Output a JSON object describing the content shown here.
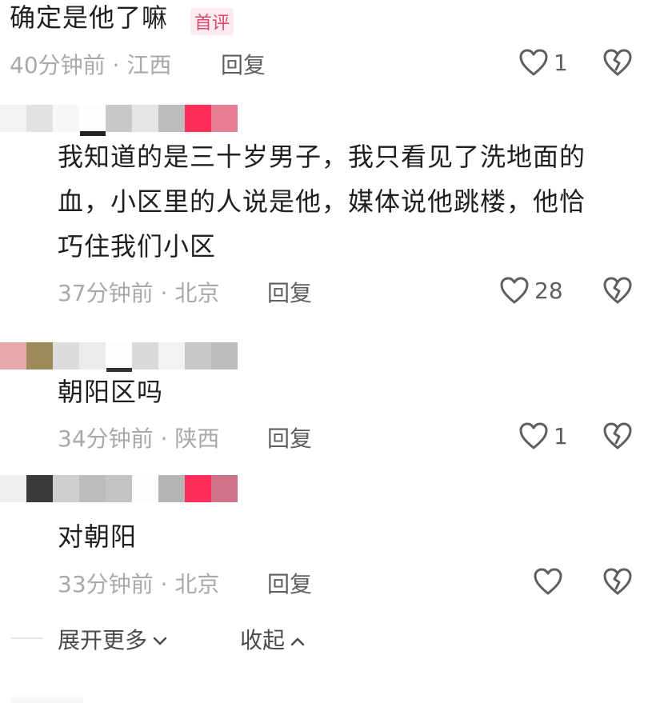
{
  "comments": [
    {
      "text_lines": [
        "确定是他了嘛"
      ],
      "badge": "首评",
      "time": "40分钟前",
      "location": "江西",
      "reply_label": "回复",
      "likes": "1"
    },
    {
      "text_lines": [
        "我知道的是三十岁男子，我只看见了洗地面的",
        "血，小区里的人说是他，媒体说他跳楼，他恰",
        "巧住我们小区"
      ],
      "time": "37分钟前",
      "location": "北京",
      "reply_label": "回复",
      "likes": "28"
    },
    {
      "text_lines": [
        "朝阳区吗"
      ],
      "time": "34分钟前",
      "location": "陕西",
      "reply_label": "回复",
      "likes": "1"
    },
    {
      "text_lines": [
        "对朝阳"
      ],
      "time": "33分钟前",
      "location": "北京",
      "reply_label": "回复",
      "likes": ""
    }
  ],
  "meta_separator": "·",
  "footer": {
    "expand_label": "展开更多",
    "collapse_label": "收起"
  },
  "icons": {
    "like": "heart-outline-icon",
    "dislike": "broken-heart-icon",
    "expand": "chevron-down-icon",
    "collapse": "chevron-up-icon"
  },
  "colors": {
    "badge_text": "#d94a6a",
    "badge_bg": "#fcecef",
    "mosaic_pink": "#ff3b6b"
  }
}
